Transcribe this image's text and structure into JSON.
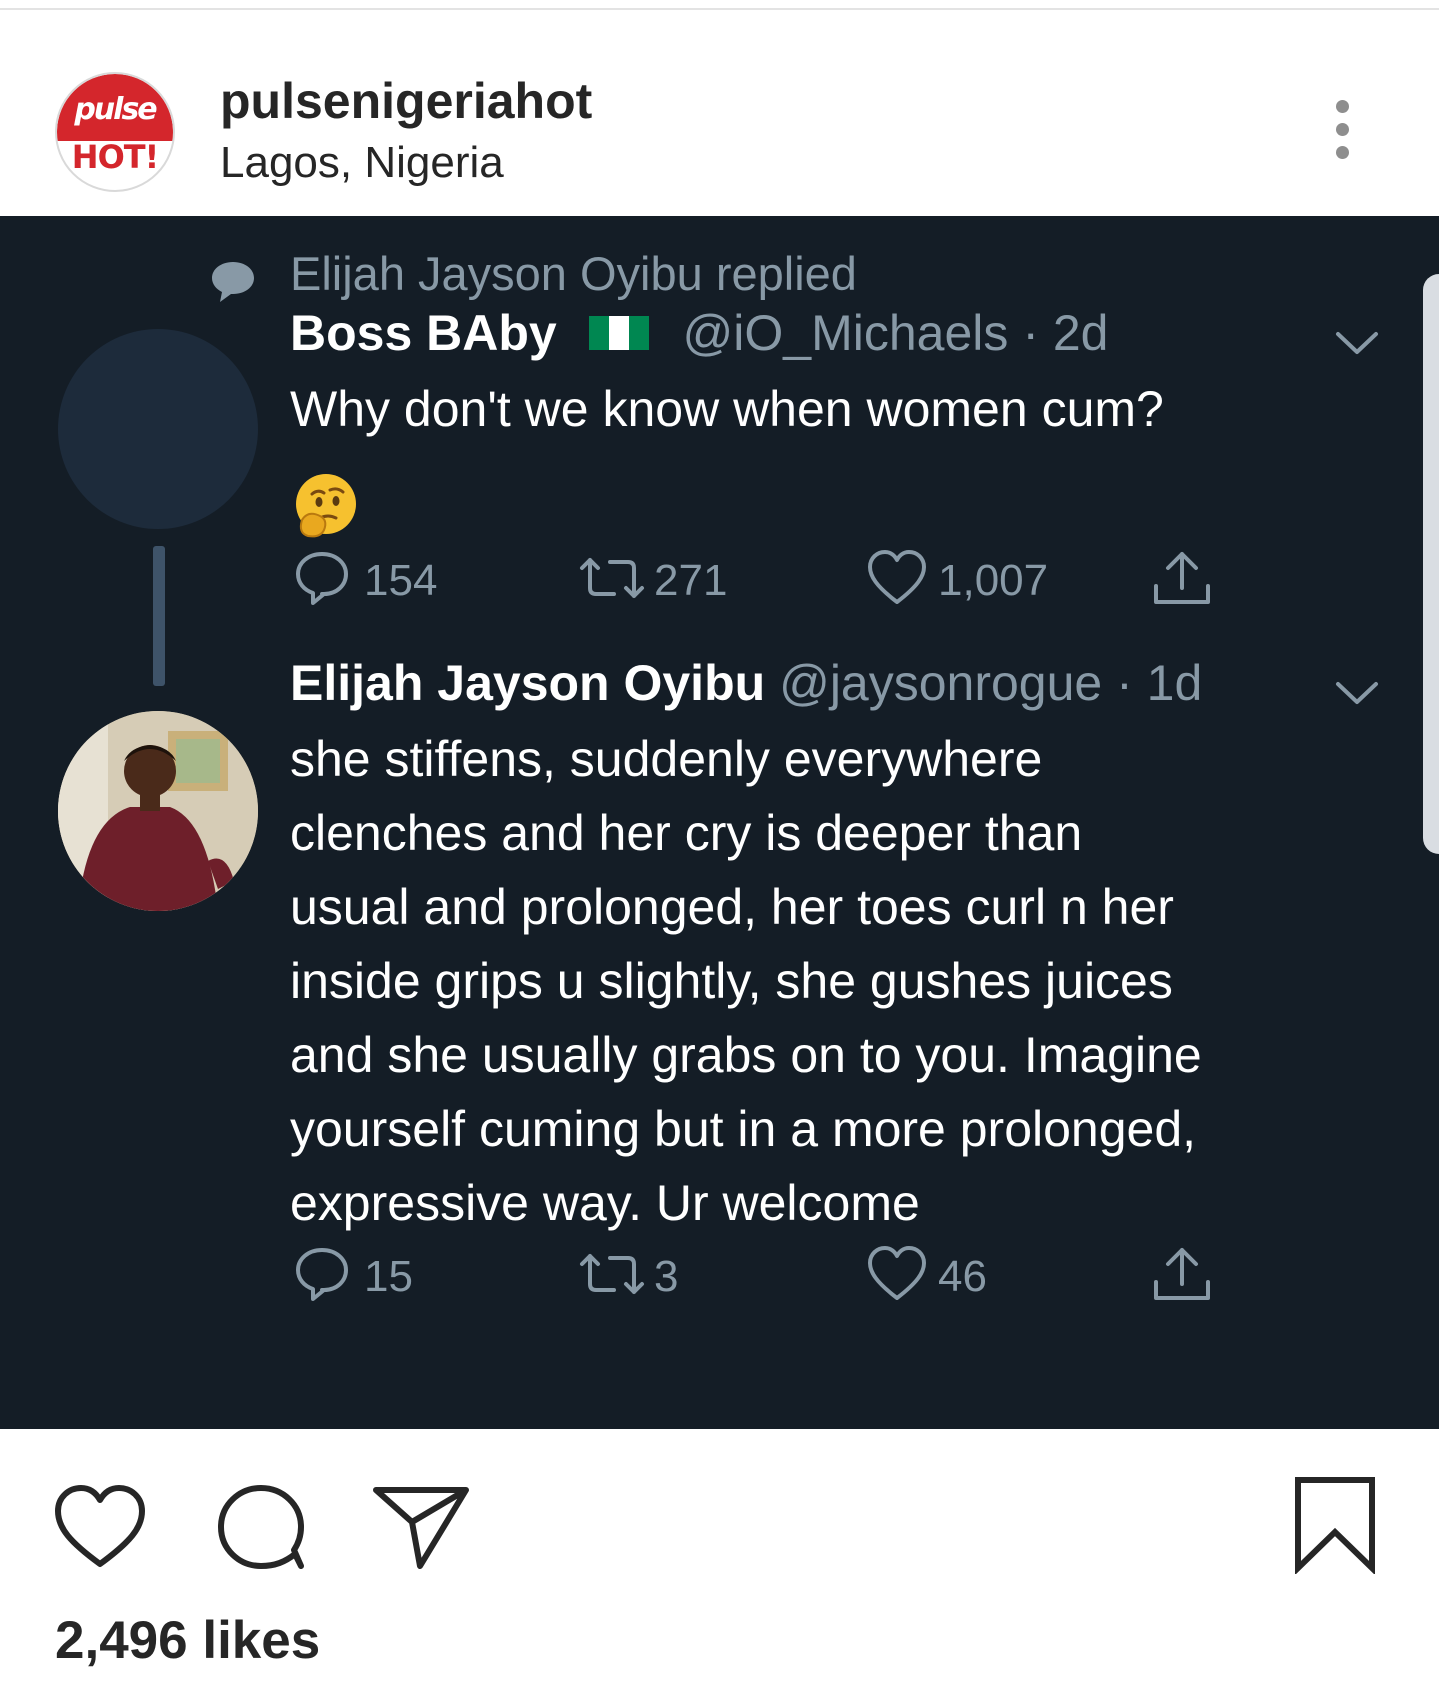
{
  "post": {
    "username": "pulsenigeriahot",
    "location": "Lagos, Nigeria",
    "avatar_logo": {
      "word": "pulse",
      "tag": "HOT!"
    },
    "likes": "2,496 likes"
  },
  "tweet_screenshot": {
    "reply_note": "Elijah Jayson Oyibu replied",
    "original": {
      "name": "Boss BAby",
      "handle": "@iO_Michaels",
      "time": "· 2d",
      "text": "Why don't we know when women cum?",
      "emoji": "thinking-face",
      "counts": {
        "replies": "154",
        "retweets": "271",
        "likes": "1,007"
      }
    },
    "reply": {
      "name": "Elijah Jayson Oyibu",
      "handle": "@jaysonrogue",
      "time": "· 1d",
      "lines": [
        "she stiffens, suddenly everywhere",
        "clenches and her cry is deeper than",
        "usual and prolonged, her toes curl n her",
        "inside grips u slightly, she gushes juices",
        "and she usually grabs on to you. Imagine",
        "yourself cuming but in a more prolonged,",
        "expressive way. Ur welcome"
      ],
      "counts": {
        "replies": "15",
        "retweets": "3",
        "likes": "46"
      }
    }
  },
  "colors": {
    "tweet_bg": "#141d26",
    "muted": "#8899a6",
    "brand_red": "#d4262c",
    "flag_green": "#008751"
  },
  "icons": [
    "more-options-icon",
    "speech-bubble-icon",
    "chevron-down-icon",
    "reply-icon",
    "retweet-icon",
    "heart-icon",
    "share-icon",
    "comment-icon",
    "send-icon",
    "bookmark-icon"
  ]
}
